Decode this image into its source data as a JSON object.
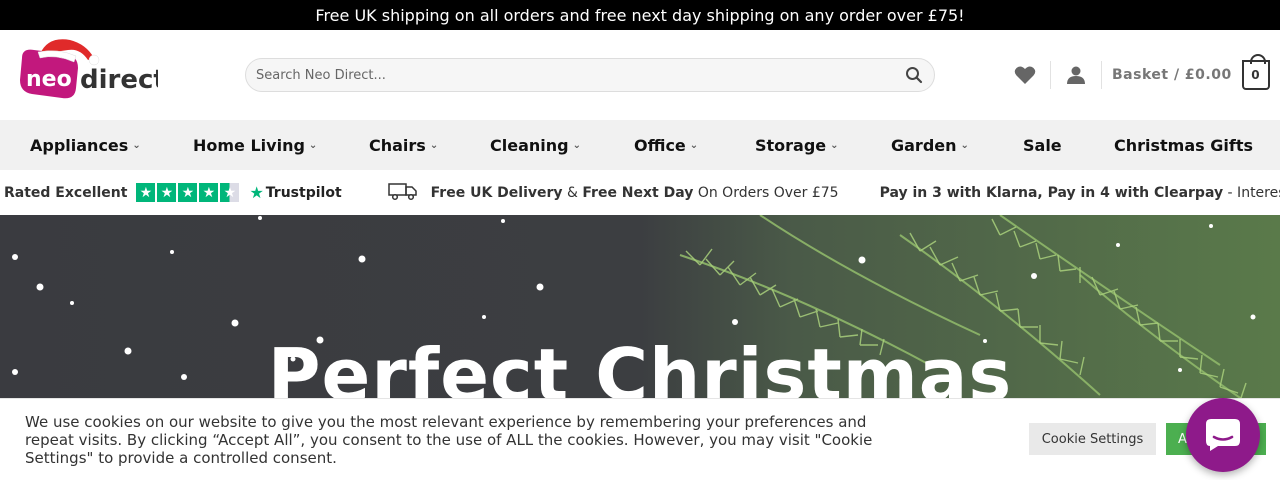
{
  "announcement": "Free UK shipping on all orders and free next day shipping on any order over £75!",
  "logo": {
    "word1": "neo",
    "word2": "direct"
  },
  "search": {
    "placeholder": "Search Neo Direct..."
  },
  "basket": {
    "label": "Basket / £0.00",
    "count": "0"
  },
  "nav": {
    "items": [
      {
        "label": "Appliances",
        "dropdown": true
      },
      {
        "label": "Home Living",
        "dropdown": true
      },
      {
        "label": "Chairs",
        "dropdown": true
      },
      {
        "label": "Cleaning",
        "dropdown": true
      },
      {
        "label": "Office",
        "dropdown": true
      },
      {
        "label": "Storage",
        "dropdown": true
      },
      {
        "label": "Garden",
        "dropdown": true
      },
      {
        "label": "Sale",
        "dropdown": false
      },
      {
        "label": "Christmas Gifts",
        "dropdown": false
      }
    ]
  },
  "trust": {
    "rated": "Rated Excellent",
    "trustpilot": "Trustpilot",
    "stars": 4.5,
    "delivery_a": "Free UK Delivery",
    "delivery_amp": " & ",
    "delivery_b": "Free Next Day",
    "delivery_c": " On Orders Over £75",
    "finance_a": "Pay in 3 with Klarna, Pay in 4 with Clearpay",
    "finance_b": " - Interest Free"
  },
  "hero": {
    "title": "Perfect Christmas"
  },
  "cookie": {
    "text": "We use cookies on our website to give you the most relevant experience by remembering your preferences and repeat visits. By clicking “Accept All”, you consent to the use of ALL the cookies. However, you may visit \"Cookie Settings\" to provide a controlled consent.",
    "settings_label": "Cookie Settings",
    "accept_label": "Accept All"
  },
  "colors": {
    "brand": "#c2187d",
    "accent_green": "#00b67a",
    "chat": "#8e1a8a",
    "accept": "#4caf50"
  }
}
